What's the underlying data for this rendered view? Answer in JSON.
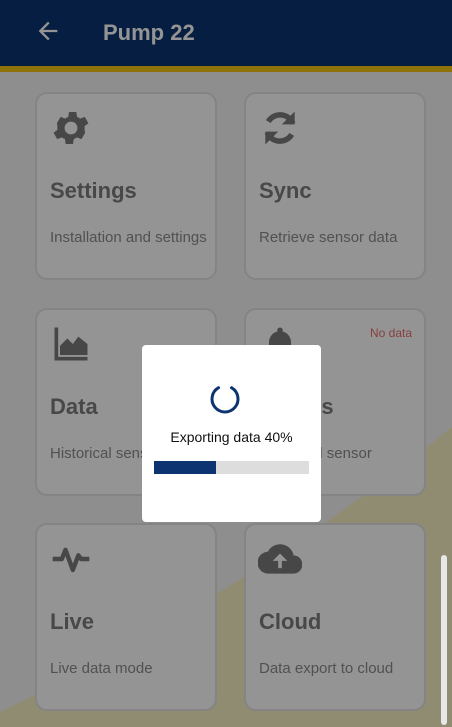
{
  "app_bar": {
    "title": "Pump 22",
    "back_icon": "arrow-left-icon"
  },
  "cards": [
    {
      "title": "Settings",
      "description": "Installation and settings",
      "icon": "gear-icon"
    },
    {
      "title": "Sync",
      "description": "Retrieve sensor data",
      "icon": "sync-icon"
    },
    {
      "title": "Data",
      "description": "Historical sensor data",
      "icon": "area-chart-icon"
    },
    {
      "title": "Alarms",
      "description": "Triggered sensor",
      "icon": "bell-icon",
      "badge": "No data"
    },
    {
      "title": "Live",
      "description": "Live data mode",
      "icon": "pulse-icon"
    },
    {
      "title": "Cloud",
      "description": "Data export to cloud",
      "icon": "cloud-upload-icon"
    }
  ],
  "dialog": {
    "text": "Exporting data 40%",
    "progress": 0.4
  },
  "colors": {
    "primary": "#0b3470",
    "accent": "#f2c40f",
    "badge": "#e97070"
  }
}
